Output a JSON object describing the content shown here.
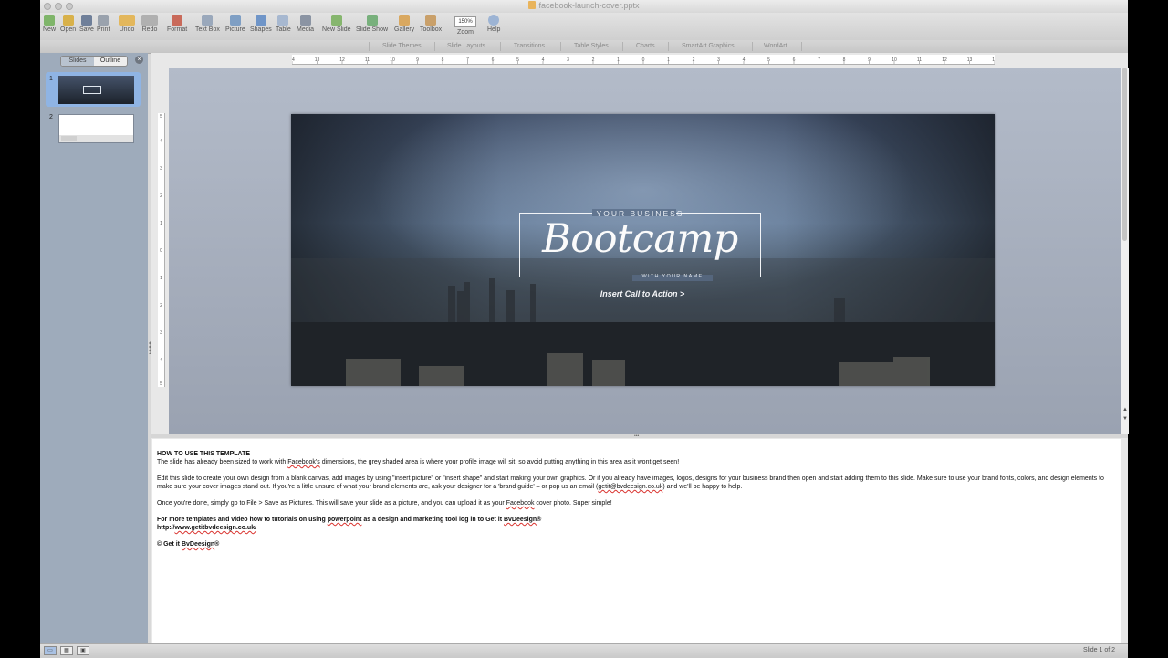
{
  "window": {
    "title": "facebook-launch-cover.pptx"
  },
  "toolbar": {
    "new": "New",
    "open": "Open",
    "save": "Save",
    "print": "Print",
    "undo": "Undo",
    "redo": "Redo",
    "format": "Format",
    "text_box": "Text Box",
    "picture": "Picture",
    "shapes": "Shapes",
    "table": "Table",
    "media": "Media",
    "new_slide": "New Slide",
    "slide_show": "Slide Show",
    "gallery": "Gallery",
    "toolbox": "Toolbox",
    "zoom_value": "150%",
    "zoom": "Zoom",
    "help": "Help"
  },
  "ribbon": {
    "tabs": [
      "Slide Themes",
      "Slide Layouts",
      "Transitions",
      "Table Styles",
      "Charts",
      "SmartArt Graphics",
      "WordArt"
    ]
  },
  "sidebar": {
    "tab_slides": "Slides",
    "tab_outline": "Outline",
    "close": "×",
    "thumb1_number": "1",
    "thumb2_number": "2"
  },
  "ruler": {
    "h_ticks": [
      "14",
      "13",
      "12",
      "11",
      "10",
      "9",
      "8",
      "7",
      "6",
      "5",
      "4",
      "3",
      "2",
      "1",
      "0",
      "1",
      "2",
      "3",
      "4",
      "5",
      "6",
      "7",
      "8",
      "9",
      "10",
      "11",
      "12",
      "13",
      "14"
    ],
    "v_ticks": [
      "5",
      "4",
      "3",
      "2",
      "1",
      "0",
      "1",
      "2",
      "3",
      "4",
      "5"
    ]
  },
  "slide": {
    "kicker": "YOUR BUSINESS",
    "headline": "Bootcamp",
    "subline": "WITH YOUR NAME",
    "cta": "Insert Call to Action >"
  },
  "notes": {
    "heading": "HOW TO USE THIS TEMPLATE",
    "p1_a": "The slide has already been sized to work with ",
    "p1_link": "Facebook's",
    "p1_b": " dimensions, the grey shaded area is where your profile image will sit, so avoid putting anything in this area as it wont get seen!",
    "p2_a": "Edit this slide to create your own design from a blank canvas, add images by using \"insert picture\" or \"insert shape\" and start making your own graphics. Or if you already have images, logos, designs for your business brand then open and start adding them to this slide. Make sure to use your brand fonts, colors, and design elements to make sure your cover images stand out. If you're a little unsure of what your brand elements are, ask your designer for a 'brand guide' – or pop us an email (",
    "p2_email": "getit@bvdeesign.co.uk",
    "p2_b": ") and we'll be happy to help.",
    "p3_a": "Once you're done, simply go to File > Save as Pictures. This will save your slide as a picture, and you can upload it as your ",
    "p3_link": "Facebook",
    "p3_b": " cover photo. Super simple!",
    "p4_a": "For more templates and video how to tutorials on using ",
    "p4_link": "powerpoint",
    "p4_b": " as a design and marketing tool log in to Get it ",
    "p4_brand": "BvDeesign",
    "p4_reg": "®",
    "p5_a": "http://",
    "p5_link": "www.getitbvdeesign.co.uk/",
    "p6_a": "© Get it ",
    "p6_brand": "BvDeesign",
    "p6_reg": "®"
  },
  "status": {
    "slide_count": "Slide 1 of 2"
  },
  "colors": {
    "sidebar_bg": "#9eabbb",
    "canvas_bg": "#a9b1c0",
    "selection": "#8fb4e4",
    "spellcheck": "#d9322e"
  }
}
